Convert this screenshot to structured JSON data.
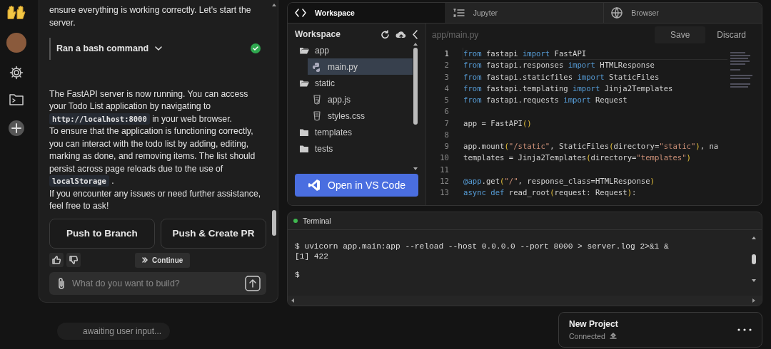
{
  "chat": {
    "intro": "ensure everything is working correctly. Let's start the server.",
    "tool_step": {
      "label": "Ran a bash command",
      "expanded": false,
      "done": true
    },
    "message": [
      [
        {
          "kind": "text",
          "text": "The FastAPI server is now running. You can access your Todo List application by navigating to "
        },
        {
          "kind": "code",
          "text": "http://localhost:8000"
        },
        {
          "kind": "text",
          "text": " in your web browser."
        }
      ],
      [
        {
          "kind": "text",
          "text": "To ensure that the application is functioning correctly, you can interact with the todo list by adding, editing, marking as done, and removing items. The list should persist across page reloads due to the use of "
        },
        {
          "kind": "code",
          "text": "localStorage"
        },
        {
          "kind": "text",
          "text": " ."
        }
      ],
      [
        {
          "kind": "text",
          "text": "If you encounter any issues or need further assistance, feel free to ask!"
        }
      ]
    ],
    "actions": [
      "Push to Branch",
      "Push & Create PR"
    ],
    "continue_label": "Continue",
    "input": {
      "placeholder": "What do you want to build?"
    }
  },
  "status": {
    "text": "awaiting user input..."
  },
  "workspace": {
    "tabs": [
      {
        "label": "Workspace",
        "kind": "code",
        "selected": true
      },
      {
        "label": "Jupyter",
        "kind": "list",
        "selected": false
      },
      {
        "label": "Browser",
        "kind": "globe",
        "selected": false
      }
    ],
    "explorer": {
      "title": "Workspace",
      "tree": [
        {
          "name": "app",
          "kind": "folder",
          "expanded": true,
          "selected": false,
          "children": [
            {
              "name": "main.py",
              "kind": "python",
              "selected": true
            }
          ]
        },
        {
          "name": "static",
          "kind": "folder",
          "expanded": true,
          "selected": false,
          "children": [
            {
              "name": "app.js",
              "kind": "js",
              "selected": false
            },
            {
              "name": "styles.css",
              "kind": "css",
              "selected": false
            }
          ]
        },
        {
          "name": "templates",
          "kind": "folder",
          "expanded": false,
          "selected": false
        },
        {
          "name": "tests",
          "kind": "folder",
          "expanded": false,
          "selected": false
        }
      ]
    },
    "open_button": "Open in VS Code",
    "editor": {
      "path": "app/main.py",
      "save": "Save",
      "discard": "Discard",
      "lines": [
        {
          "number": "1",
          "current": true,
          "tokens": [
            {
              "kind": "kw",
              "text": "from"
            },
            {
              "kind": "plain",
              "text": " fastapi "
            },
            {
              "kind": "kw",
              "text": "import"
            },
            {
              "kind": "plain",
              "text": " FastAPI"
            }
          ]
        },
        {
          "number": "2",
          "current": false,
          "tokens": [
            {
              "kind": "kw",
              "text": "from"
            },
            {
              "kind": "plain",
              "text": " fastapi.responses "
            },
            {
              "kind": "kw",
              "text": "import"
            },
            {
              "kind": "plain",
              "text": " HTMLResponse"
            }
          ]
        },
        {
          "number": "3",
          "current": false,
          "tokens": [
            {
              "kind": "kw",
              "text": "from"
            },
            {
              "kind": "plain",
              "text": " fastapi.staticfiles "
            },
            {
              "kind": "kw",
              "text": "import"
            },
            {
              "kind": "plain",
              "text": " StaticFiles"
            }
          ]
        },
        {
          "number": "4",
          "current": false,
          "tokens": [
            {
              "kind": "kw",
              "text": "from"
            },
            {
              "kind": "plain",
              "text": " fastapi.templating "
            },
            {
              "kind": "kw",
              "text": "import"
            },
            {
              "kind": "plain",
              "text": " Jinja2Templates"
            }
          ]
        },
        {
          "number": "5",
          "current": false,
          "tokens": [
            {
              "kind": "kw",
              "text": "from"
            },
            {
              "kind": "plain",
              "text": " fastapi.requests "
            },
            {
              "kind": "kw",
              "text": "import"
            },
            {
              "kind": "plain",
              "text": " Request"
            }
          ]
        },
        {
          "number": "6",
          "current": false
        },
        {
          "number": "7",
          "current": false,
          "tokens": [
            {
              "kind": "plain",
              "text": "app = FastAPI"
            },
            {
              "kind": "paren",
              "text": "()"
            }
          ]
        },
        {
          "number": "8",
          "current": false
        },
        {
          "number": "9",
          "current": false,
          "tokens": [
            {
              "kind": "plain",
              "text": "app.mount"
            },
            {
              "kind": "paren",
              "text": "("
            },
            {
              "kind": "str",
              "text": "\"/static\""
            },
            {
              "kind": "plain",
              "text": ", StaticFiles"
            },
            {
              "kind": "paren",
              "text": "("
            },
            {
              "kind": "plain",
              "text": "directory="
            },
            {
              "kind": "str",
              "text": "\"static\""
            },
            {
              "kind": "paren",
              "text": ")"
            },
            {
              "kind": "plain",
              "text": ", na"
            }
          ]
        },
        {
          "number": "10",
          "current": false,
          "tokens": [
            {
              "kind": "plain",
              "text": "templates = Jinja2Templates"
            },
            {
              "kind": "paren",
              "text": "("
            },
            {
              "kind": "plain",
              "text": "directory="
            },
            {
              "kind": "str",
              "text": "\"templates\""
            },
            {
              "kind": "paren",
              "text": ")"
            }
          ]
        },
        {
          "number": "11",
          "current": false
        },
        {
          "number": "12",
          "current": false,
          "tokens": [
            {
              "kind": "kw",
              "text": "@app"
            },
            {
              "kind": "plain",
              "text": ".get"
            },
            {
              "kind": "paren",
              "text": "("
            },
            {
              "kind": "str",
              "text": "\"/\""
            },
            {
              "kind": "plain",
              "text": ", response_class=HTMLResponse"
            },
            {
              "kind": "paren",
              "text": ")"
            }
          ]
        },
        {
          "number": "13",
          "current": false,
          "tokens": [
            {
              "kind": "kw",
              "text": "async def"
            },
            {
              "kind": "plain",
              "text": " read_root"
            },
            {
              "kind": "paren",
              "text": "("
            },
            {
              "kind": "plain",
              "text": "request: Request"
            },
            {
              "kind": "paren",
              "text": ")"
            },
            {
              "kind": "plain",
              "text": ":"
            }
          ]
        }
      ]
    }
  },
  "terminal": {
    "title": "Terminal",
    "active": true,
    "lines": [
      "$ uvicorn app.main:app --reload --host 0.0.0.0 --port 8000 > server.log 2>&1 &",
      "[1] 422"
    ],
    "prompt": "$"
  },
  "project": {
    "name": "New Project",
    "status": "Connected"
  }
}
